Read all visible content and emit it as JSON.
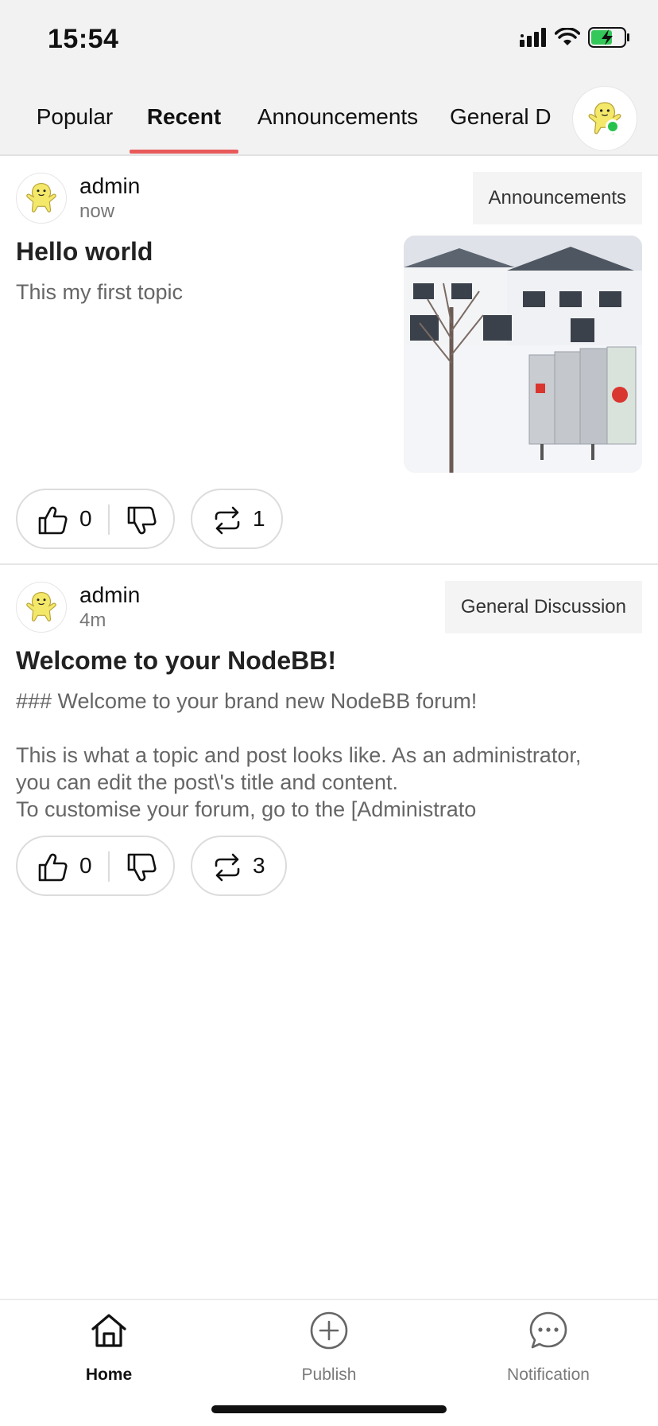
{
  "status_bar": {
    "time": "15:54"
  },
  "tabs": [
    {
      "label": "Popular",
      "active": false
    },
    {
      "label": "Recent",
      "active": true
    },
    {
      "label": "Announcements",
      "active": false
    },
    {
      "label": "General D",
      "active": false
    }
  ],
  "colors": {
    "accent": "#e85a5a",
    "online": "#27c24c"
  },
  "posts": [
    {
      "author": "admin",
      "time": "now",
      "category": "Announcements",
      "title": "Hello world",
      "excerpt_lines": [
        "This my first topic"
      ],
      "has_image": true,
      "upvotes": "0",
      "reposts": "1"
    },
    {
      "author": "admin",
      "time": "4m",
      "category": "General Discussion",
      "title": "Welcome to your NodeBB!",
      "excerpt_lines": [
        "### Welcome to your brand new NodeBB forum!",
        "",
        "This is what a topic and post looks like. As an administrator,",
        "you can edit the post\\'s title and content.",
        "To customise your forum, go to the [Administrato"
      ],
      "has_image": false,
      "upvotes": "0",
      "reposts": "3"
    }
  ],
  "bottom_nav": [
    {
      "label": "Home",
      "icon": "home-icon",
      "active": true
    },
    {
      "label": "Publish",
      "icon": "plus-circle-icon",
      "active": false
    },
    {
      "label": "Notification",
      "icon": "chat-bubble-icon",
      "active": false
    }
  ]
}
